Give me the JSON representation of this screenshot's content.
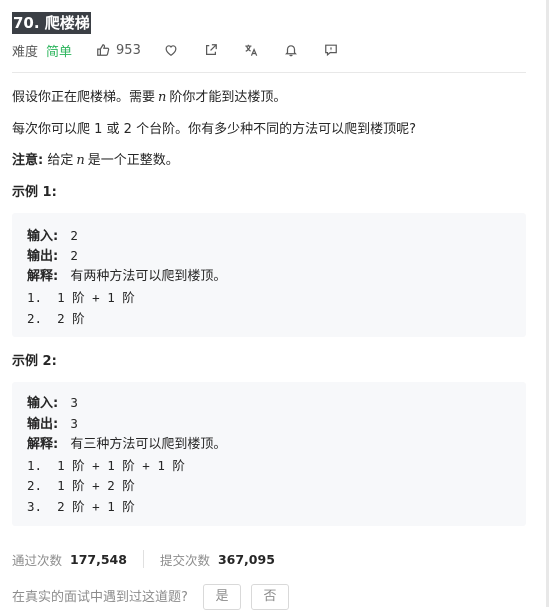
{
  "problem": {
    "title": "70. 爬楼梯",
    "difficulty_label": "难度",
    "difficulty": "简单",
    "likes": "953"
  },
  "description": {
    "p1_before": "假设你正在爬楼梯。需要",
    "p1_var": "n",
    "p1_after": "阶你才能到达楼顶。",
    "p2": "每次你可以爬 1 或 2 个台阶。你有多少种不同的方法可以爬到楼顶呢?",
    "note_label": "注意:",
    "note_before": "给定",
    "note_var": "n",
    "note_after": "是一个正整数。"
  },
  "examples": [
    {
      "heading": "示例 1:",
      "input_label": "输入:",
      "input": "2",
      "output_label": "输出:",
      "output": "2",
      "explain_label": "解释:",
      "explain": "有两种方法可以爬到楼顶。",
      "steps": [
        "1.  1 阶 + 1 阶",
        "2.  2 阶"
      ]
    },
    {
      "heading": "示例 2:",
      "input_label": "输入:",
      "input": "3",
      "output_label": "输出:",
      "output": "3",
      "explain_label": "解释:",
      "explain": "有三种方法可以爬到楼顶。",
      "steps": [
        "1.  1 阶 + 1 阶 + 1 阶",
        "2.  1 阶 + 2 阶",
        "3.  2 阶 + 1 阶"
      ]
    }
  ],
  "stats": {
    "accepted_label": "通过次数",
    "accepted": "177,548",
    "submissions_label": "提交次数",
    "submissions": "367,095"
  },
  "interview": {
    "question": "在真实的面试中遇到过这道题?",
    "yes": "是",
    "no": "否"
  },
  "icons": [
    "thumbs-up-icon",
    "heart-icon",
    "share-icon",
    "translate-icon",
    "bell-icon",
    "comment-icon"
  ],
  "colors": {
    "easy": "#2db55d",
    "title_bg": "#3b3f45",
    "example_bg": "#f7f8fa"
  }
}
